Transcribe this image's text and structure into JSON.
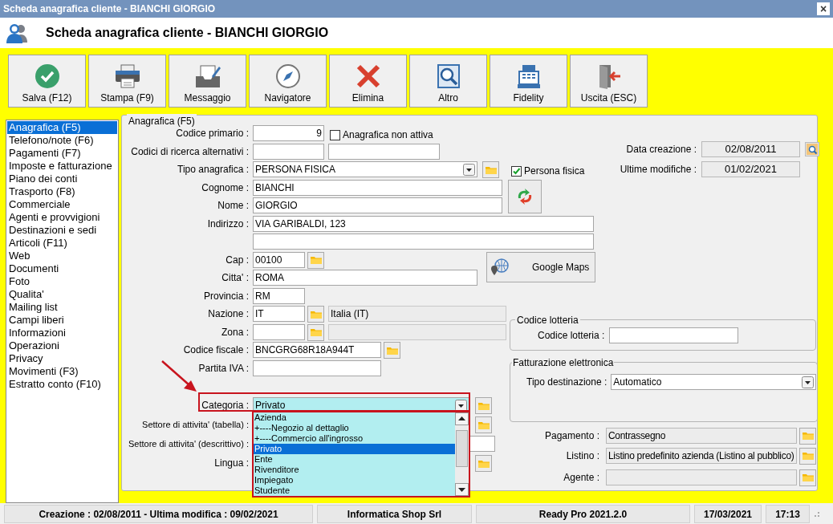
{
  "window": {
    "title": "Scheda anagrafica cliente - BIANCHI GIORGIO",
    "close": "×"
  },
  "header": {
    "title": "Scheda anagrafica cliente - BIANCHI GIORGIO"
  },
  "toolbar": [
    {
      "label": "Salva (F12)"
    },
    {
      "label": "Stampa (F9)"
    },
    {
      "label": "Messaggio"
    },
    {
      "label": "Navigatore"
    },
    {
      "label": "Elimina"
    },
    {
      "label": "Altro"
    },
    {
      "label": "Fidelity"
    },
    {
      "label": "Uscita (ESC)"
    }
  ],
  "sidebar": {
    "items": [
      {
        "label": "Anagrafica (F5)",
        "selected": true
      },
      {
        "label": "Telefono/note (F6)",
        "selected": false
      },
      {
        "label": "Pagamenti (F7)",
        "selected": false
      },
      {
        "label": "Imposte e fatturazione",
        "selected": false
      },
      {
        "label": "Piano dei conti",
        "selected": false
      },
      {
        "label": "Trasporto (F8)",
        "selected": false
      },
      {
        "label": "Commerciale",
        "selected": false
      },
      {
        "label": "Agenti e provvigioni",
        "selected": false
      },
      {
        "label": "Destinazioni e sedi",
        "selected": false
      },
      {
        "label": "Articoli (F11)",
        "selected": false
      },
      {
        "label": "Web",
        "selected": false
      },
      {
        "label": "Documenti",
        "selected": false
      },
      {
        "label": "Foto",
        "selected": false
      },
      {
        "label": "Qualita'",
        "selected": false
      },
      {
        "label": "Mailing list",
        "selected": false
      },
      {
        "label": "Campi liberi",
        "selected": false
      },
      {
        "label": "Informazioni",
        "selected": false
      },
      {
        "label": "Operazioni",
        "selected": false
      },
      {
        "label": "Privacy",
        "selected": false
      },
      {
        "label": "Movimenti (F3)",
        "selected": false
      },
      {
        "label": "Estratto conto (F10)",
        "selected": false
      }
    ]
  },
  "form": {
    "group_title": "Anagrafica (F5)",
    "codice_primario": {
      "label": "Codice primario :",
      "value": "9"
    },
    "anagrafica_non_attiva": {
      "label": "Anagrafica non attiva",
      "checked": false
    },
    "codici_ricerca": {
      "label": "Codici di ricerca alternativi :"
    },
    "tipo_anagrafica": {
      "label": "Tipo anagrafica :",
      "value": "PERSONA FISICA"
    },
    "persona_fisica": {
      "label": "Persona fisica",
      "checked": true
    },
    "cognome": {
      "label": "Cognome :",
      "value": "BIANCHI"
    },
    "nome": {
      "label": "Nome :",
      "value": "GIORGIO"
    },
    "indirizzo": {
      "label": "Indirizzo :",
      "value": "VIA GARIBALDI, 123"
    },
    "cap": {
      "label": "Cap :",
      "value": "00100"
    },
    "google_maps": {
      "label": "Google Maps"
    },
    "citta": {
      "label": "Citta' :",
      "value": "ROMA"
    },
    "provincia": {
      "label": "Provincia :",
      "value": "RM"
    },
    "nazione": {
      "label": "Nazione :",
      "value": "IT",
      "description": "Italia (IT)"
    },
    "zona": {
      "label": "Zona :"
    },
    "codice_fiscale": {
      "label": "Codice fiscale :",
      "value": "BNCGRG68R18A944T"
    },
    "partita_iva": {
      "label": "Partita IVA :"
    },
    "categoria": {
      "label": "Categoria :",
      "value": "Privato",
      "expanded": true,
      "options": [
        {
          "label": "Azienda",
          "selected": false
        },
        {
          "label": "+----Negozio al dettaglio",
          "selected": false
        },
        {
          "label": "+----Commercio all'ingrosso",
          "selected": false
        },
        {
          "label": "Privato",
          "selected": true
        },
        {
          "label": "Ente",
          "selected": false
        },
        {
          "label": "Rivenditore",
          "selected": false
        },
        {
          "label": "Impiegato",
          "selected": false
        },
        {
          "label": "Studente",
          "selected": false
        }
      ]
    },
    "settore_tabella": {
      "label": "Settore di attivita' (tabella) :"
    },
    "settore_descrittivo": {
      "label": "Settore di attivita' (descrittivo) :"
    },
    "lingua": {
      "label": "Lingua :"
    },
    "data_creazione": {
      "label": "Data creazione :",
      "value": "02/08/2011"
    },
    "ultime_modifiche": {
      "label": "Ultime modifiche :",
      "value": "01/02/2021"
    },
    "lotteria": {
      "group_title": "Codice lotteria",
      "label": "Codice lotteria :"
    },
    "fatturazione": {
      "group_title": "Fatturazione elettronica",
      "label": "Tipo destinazione :",
      "value": "Automatico"
    },
    "pagamento": {
      "label": "Pagamento :",
      "value": "Contrassegno"
    },
    "listino": {
      "label": "Listino :",
      "value": "Listino predefinito azienda (Listino al pubblico)"
    },
    "agente": {
      "label": "Agente :"
    }
  },
  "status_bar": [
    "Creazione : 02/08/2011 - Ultima modifica : 09/02/2021",
    "Informatica Shop Srl",
    "Ready Pro 2021.2.0",
    "17/03/2021",
    "17:13"
  ]
}
